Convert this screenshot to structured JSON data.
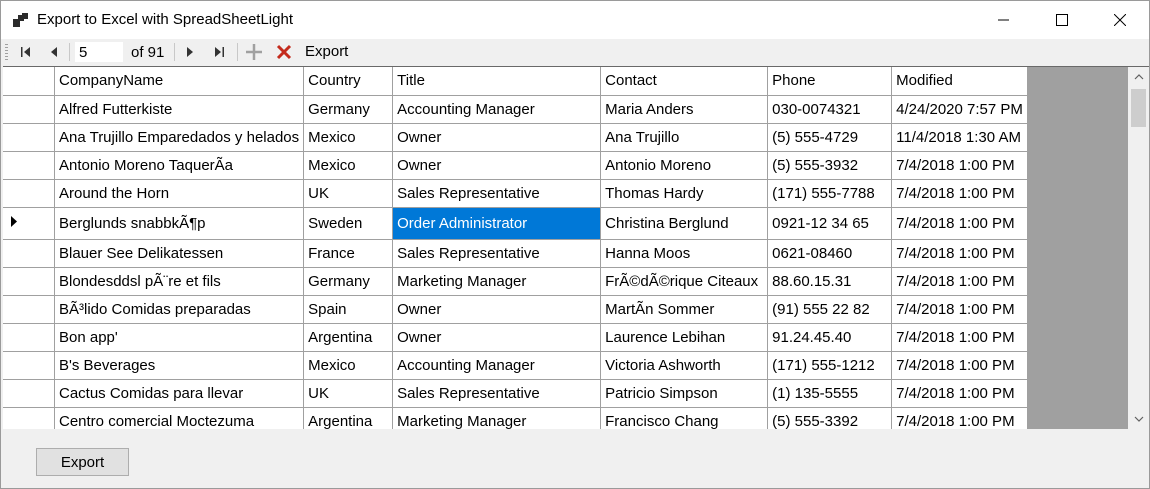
{
  "window": {
    "title": "Export to Excel with SpreadSheetLight"
  },
  "toolbar": {
    "position": "5",
    "of_label": "of 91",
    "export_label": "Export"
  },
  "grid": {
    "columns": [
      "CompanyName",
      "Country",
      "Title",
      "Contact",
      "Phone",
      "Modified"
    ],
    "rows": [
      [
        "Alfred Futterkiste",
        "Germany",
        "Accounting Manager",
        "Maria Anders",
        "030-0074321",
        "4/24/2020 7:57 PM"
      ],
      [
        "Ana Trujillo Emparedados y helados",
        "Mexico",
        "Owner",
        "Ana Trujillo",
        "(5) 555-4729",
        "11/4/2018 1:30 AM"
      ],
      [
        "Antonio Moreno TaquerÃ­a",
        "Mexico",
        "Owner",
        "Antonio Moreno",
        "(5) 555-3932",
        "7/4/2018 1:00 PM"
      ],
      [
        "Around the Horn",
        "UK",
        "Sales Representative",
        "Thomas Hardy",
        "(171) 555-7788",
        "7/4/2018 1:00 PM"
      ],
      [
        "Berglunds snabbkÃ¶p",
        "Sweden",
        "Order Administrator",
        "Christina Berglund",
        "0921-12 34 65",
        "7/4/2018 1:00 PM"
      ],
      [
        "Blauer See Delikatessen",
        "France",
        "Sales Representative",
        "Hanna Moos",
        "0621-08460",
        "7/4/2018 1:00 PM"
      ],
      [
        "Blondesddsl pÃ¨re et fils",
        "Germany",
        "Marketing Manager",
        "FrÃ©dÃ©rique Citeaux",
        "88.60.15.31",
        "7/4/2018 1:00 PM"
      ],
      [
        "BÃ³lido Comidas preparadas",
        "Spain",
        "Owner",
        "MartÃ­n Sommer",
        "(91) 555 22 82",
        "7/4/2018 1:00 PM"
      ],
      [
        "Bon app'",
        "Argentina",
        "Owner",
        "Laurence Lebihan",
        "91.24.45.40",
        "7/4/2018 1:00 PM"
      ],
      [
        "B's Beverages",
        "Mexico",
        "Accounting Manager",
        "Victoria Ashworth",
        "(171) 555-1212",
        "7/4/2018 1:00 PM"
      ],
      [
        "Cactus Comidas para llevar",
        "UK",
        "Sales Representative",
        "Patricio Simpson",
        "(1) 135-5555",
        "7/4/2018 1:00 PM"
      ],
      [
        "Centro comercial Moctezuma",
        "Argentina",
        "Marketing Manager",
        "Francisco Chang",
        "(5) 555-3392",
        "7/4/2018 1:00 PM"
      ]
    ],
    "current_row_index": 4,
    "selected_cell": {
      "row": 4,
      "column": "Title"
    }
  },
  "bottom": {
    "export_button_label": "Export"
  },
  "colors": {
    "selection": "#0078d7",
    "grid_background": "#a0a0a0",
    "delete_icon": "#c42b1c"
  }
}
